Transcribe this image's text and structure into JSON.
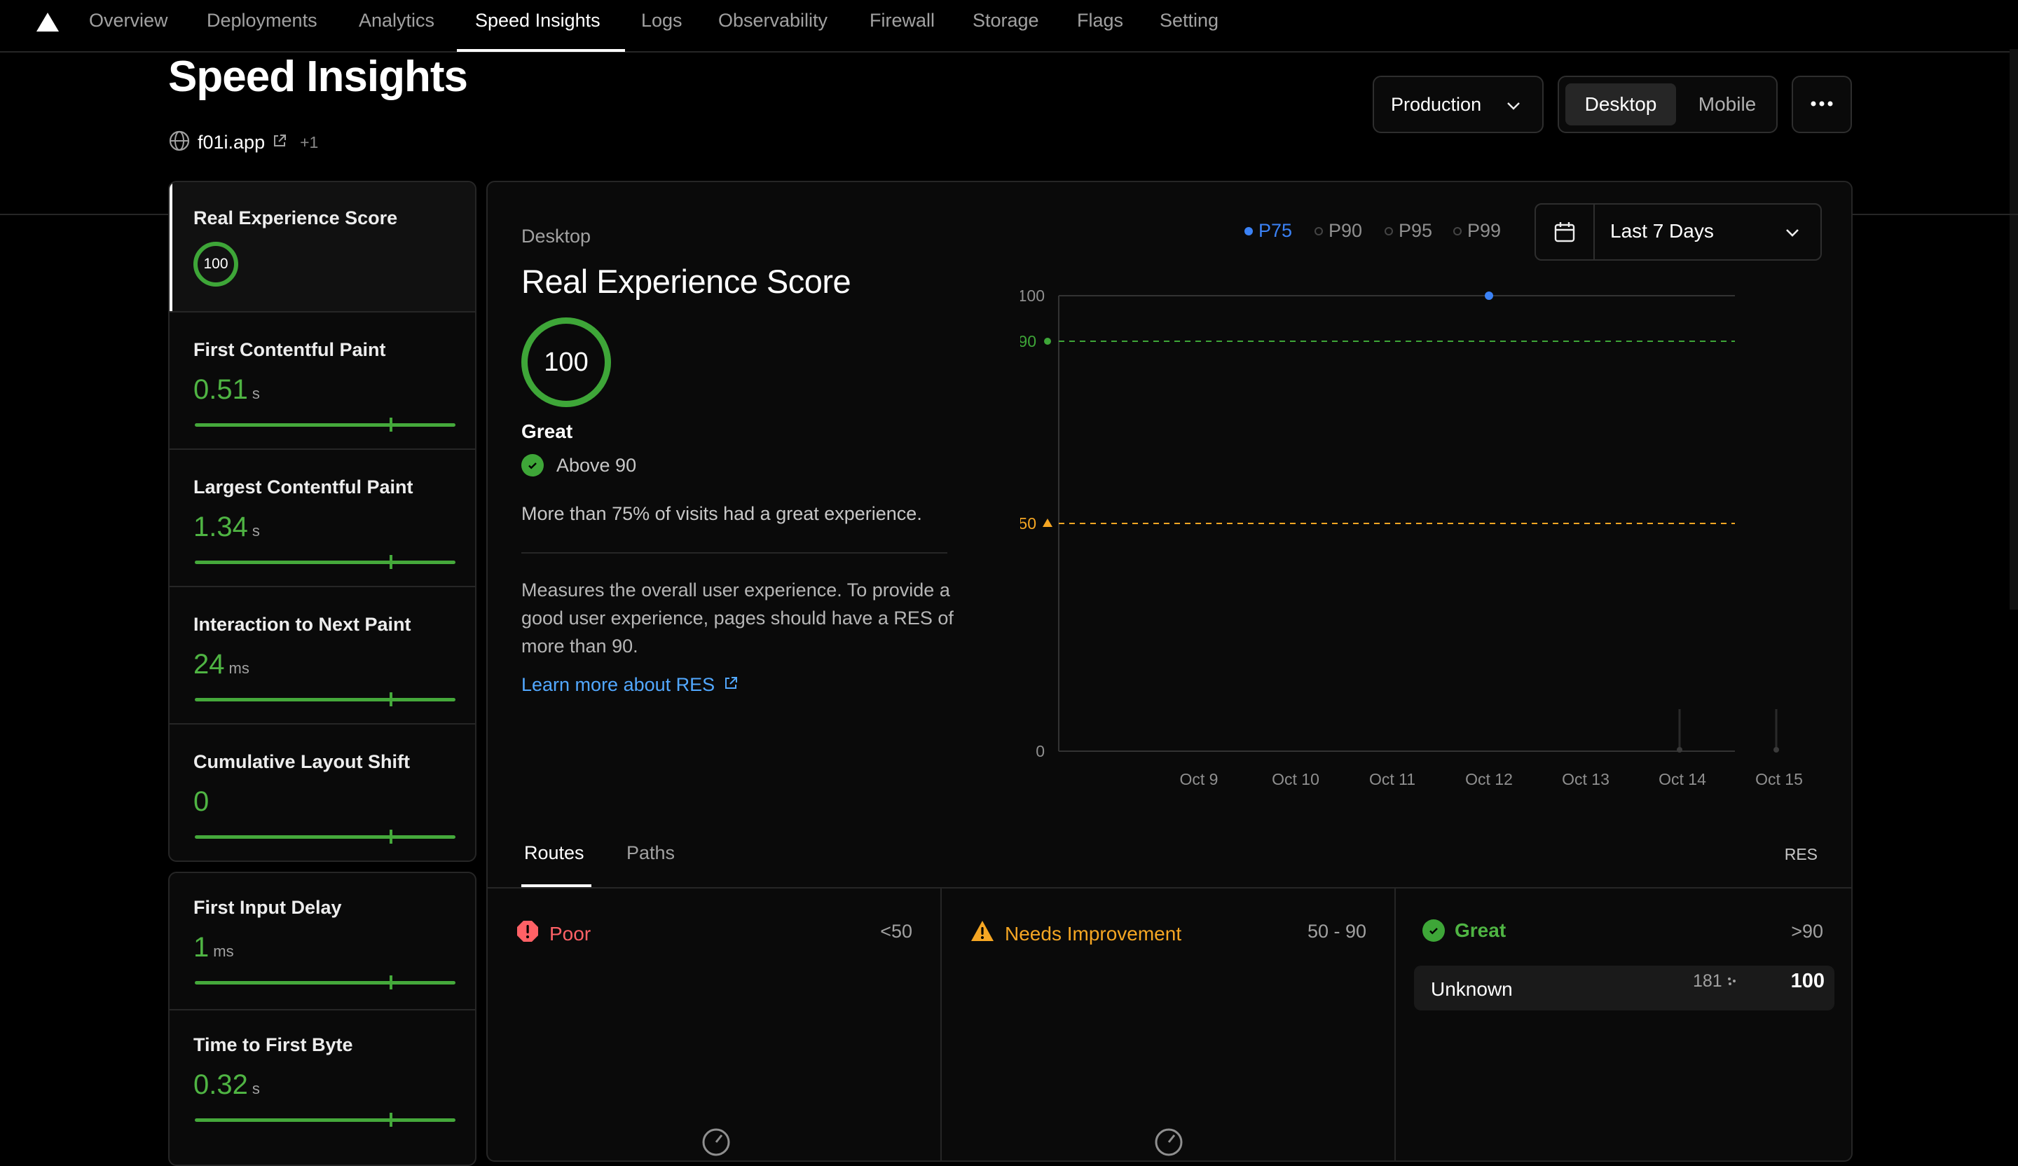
{
  "nav": {
    "tabs": [
      "Overview",
      "Deployments",
      "Analytics",
      "Speed Insights",
      "Logs",
      "Observability",
      "Firewall",
      "Storage",
      "Flags",
      "Setting"
    ],
    "active_tab": "Speed Insights"
  },
  "page": {
    "title": "Speed Insights",
    "domain": "f01i.app",
    "domain_extra": "+1"
  },
  "controls": {
    "environment": "Production",
    "device_options": [
      "Desktop",
      "Mobile"
    ],
    "device_selected": "Desktop"
  },
  "sidebar": {
    "metrics": [
      {
        "label": "Real Experience Score",
        "score": "100"
      },
      {
        "label": "First Contentful Paint",
        "value": "0.51",
        "unit": "s",
        "bar_fraction": 1.0
      },
      {
        "label": "Largest Contentful Paint",
        "value": "1.34",
        "unit": "s",
        "bar_fraction": 1.0
      },
      {
        "label": "Interaction to Next Paint",
        "value": "24",
        "unit": "ms",
        "bar_fraction": 1.0
      },
      {
        "label": "Cumulative Layout Shift",
        "value": "0",
        "unit": "",
        "bar_fraction": 1.0
      }
    ],
    "other_metrics": [
      {
        "label": "First Input Delay",
        "value": "1",
        "unit": "ms",
        "bar_fraction": 1.0
      },
      {
        "label": "Time to First Byte",
        "value": "0.32",
        "unit": "s",
        "bar_fraction": 1.0
      }
    ]
  },
  "detail": {
    "device": "Desktop",
    "title": "Real Experience Score",
    "score": "100",
    "rating": "Great",
    "threshold_text": "Above 90",
    "visits_text": "More than 75% of visits had a great experience.",
    "description": "Measures the overall user experience. To provide a good user experience, pages should have a RES of more than 90.",
    "learn_more": "Learn more about RES"
  },
  "percentiles": {
    "options": [
      "P75",
      "P90",
      "P95",
      "P99"
    ],
    "selected": "P75"
  },
  "date_range": "Last 7 Days",
  "chart_data": {
    "type": "line",
    "x": [
      "Oct 9",
      "Oct 10",
      "Oct 11",
      "Oct 12",
      "Oct 13",
      "Oct 14",
      "Oct 15"
    ],
    "series": [
      {
        "values": [
          null,
          null,
          null,
          100,
          null,
          null,
          null
        ]
      }
    ],
    "y_ticks": [
      "100",
      "0"
    ],
    "ylim": [
      0,
      100
    ],
    "thresholds": [
      {
        "label": "90",
        "value": 90,
        "color": "#3ea638"
      },
      {
        "label": "50",
        "value": 50,
        "color": "#f5a623"
      }
    ],
    "grid": false
  },
  "routes": {
    "tabs": [
      "Routes",
      "Paths"
    ],
    "active_tab": "Routes",
    "column_label": "RES",
    "buckets": [
      {
        "label": "Poor",
        "range": "<50",
        "color": "#ff6166"
      },
      {
        "label": "Needs Improvement",
        "range": "50 - 90",
        "color": "#f5a623"
      },
      {
        "label": "Great",
        "range": ">90",
        "color": "#4fb443"
      }
    ],
    "great_rows": [
      {
        "name": "Unknown",
        "count": "181",
        "score": "100"
      }
    ]
  }
}
